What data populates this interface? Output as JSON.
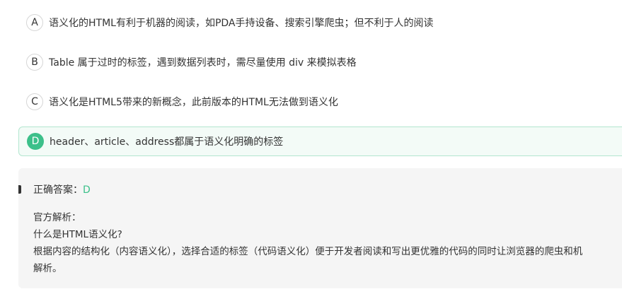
{
  "options": [
    {
      "letter": "A",
      "text": "语义化的HTML有利于机器的阅读，如PDA手持设备、搜索引擎爬虫；但不利于人的阅读",
      "selected": false
    },
    {
      "letter": "B",
      "text": "Table 属于过时的标签，遇到数据列表时，需尽量使用 div 来模拟表格",
      "selected": false
    },
    {
      "letter": "C",
      "text": "语义化是HTML5带来的新概念，此前版本的HTML无法做到语义化",
      "selected": false
    },
    {
      "letter": "D",
      "text": "header、article、address都属于语义化明确的标签",
      "selected": true
    }
  ],
  "answer": {
    "label": "正确答案：",
    "value": "D"
  },
  "analysis": {
    "title": "官方解析：",
    "question": "什么是HTML语义化?",
    "body_line1": "根据内容的结构化（内容语义化），选择合适的标签（代码语义化）便于开发者阅读和写出更优雅的代码的同时让浏览器的爬虫和机",
    "body_line2": "解析。"
  },
  "colors": {
    "accent": "#3cc08a",
    "selected_bg": "#f3fbf7",
    "selected_border": "#b3e6cf",
    "answer_bg": "#f5f5f5"
  }
}
